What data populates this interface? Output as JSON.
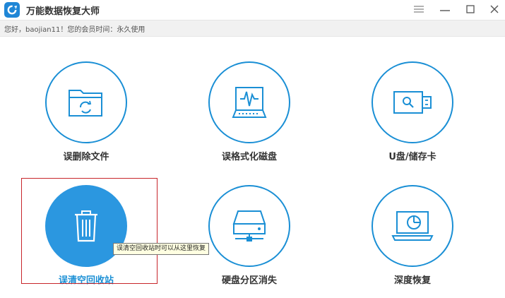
{
  "app": {
    "title": "万能数据恢复大师",
    "logo_icon": "refresh-logo-icon",
    "accent_color": "#1a8fd5"
  },
  "window_controls": {
    "menu_icon": "hamburger-menu-icon",
    "minimize_icon": "minimize-icon",
    "maximize_icon": "maximize-icon",
    "close_icon": "close-icon"
  },
  "info_bar": {
    "text": "您好，baojian11！您的会员时间：永久使用"
  },
  "tiles": [
    {
      "label": "误删除文件",
      "icon": "folder-recycle-icon"
    },
    {
      "label": "误格式化磁盘",
      "icon": "disk-waveform-icon"
    },
    {
      "label": "U盘/储存卡",
      "icon": "usb-drive-search-icon"
    },
    {
      "label": "误清空回收站",
      "icon": "recycle-bin-icon",
      "selected": true
    },
    {
      "label": "硬盘分区消失",
      "icon": "hard-drive-network-icon"
    },
    {
      "label": "深度恢复",
      "icon": "laptop-scan-icon"
    }
  ],
  "tooltip": {
    "text": "误清空回收站时可以从这里恢复"
  }
}
